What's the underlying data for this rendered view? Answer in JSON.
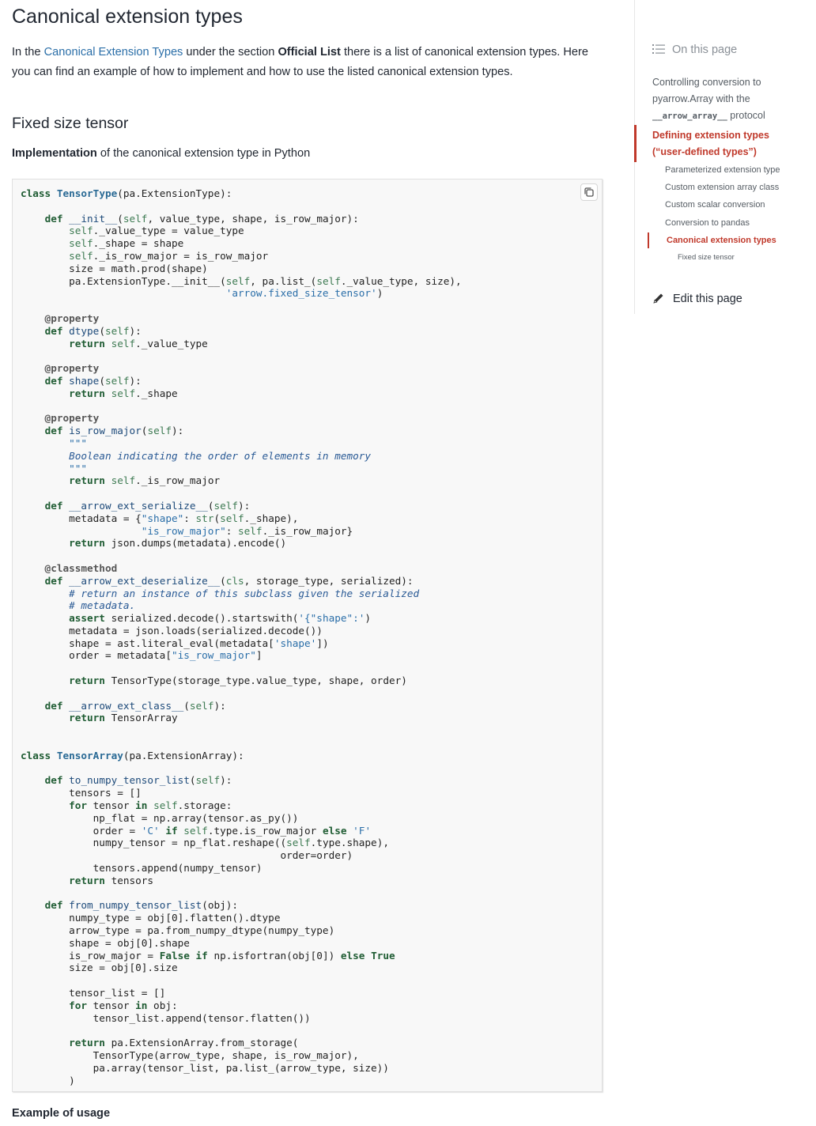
{
  "page": {
    "title": "Canonical extension types",
    "intro": {
      "prefix": "In the ",
      "link": "Canonical Extension Types",
      "middle": " under the section ",
      "bold": "Official List",
      "suffix": " there is a list of canonical extension types. Here you can find an example of how to implement and how to use the listed canonical extension types."
    },
    "section_title": "Fixed size tensor",
    "implementation": {
      "bold": "Implementation",
      "rest": " of the canonical extension type in Python"
    },
    "example_heading": "Example of usage",
    "code_lines": [
      "class TensorType(pa.ExtensionType):",
      "",
      "    def __init__(self, value_type, shape, is_row_major):",
      "        self._value_type = value_type",
      "        self._shape = shape",
      "        self._is_row_major = is_row_major",
      "        size = math.prod(shape)",
      "        pa.ExtensionType.__init__(self, pa.list_(self._value_type, size),",
      "                                  'arrow.fixed_size_tensor')",
      "",
      "    @property",
      "    def dtype(self):",
      "        return self._value_type",
      "",
      "    @property",
      "    def shape(self):",
      "        return self._shape",
      "",
      "    @property",
      "    def is_row_major(self):",
      "        \"\"\"",
      "        Boolean indicating the order of elements in memory",
      "        \"\"\"",
      "        return self._is_row_major",
      "",
      "    def __arrow_ext_serialize__(self):",
      "        metadata = {\"shape\": str(self._shape),",
      "                    \"is_row_major\": self._is_row_major}",
      "        return json.dumps(metadata).encode()",
      "",
      "    @classmethod",
      "    def __arrow_ext_deserialize__(cls, storage_type, serialized):",
      "        # return an instance of this subclass given the serialized",
      "        # metadata.",
      "        assert serialized.decode().startswith('{\"shape\":')",
      "        metadata = json.loads(serialized.decode())",
      "        shape = ast.literal_eval(metadata['shape'])",
      "        order = metadata[\"is_row_major\"]",
      "",
      "        return TensorType(storage_type.value_type, shape, order)",
      "",
      "    def __arrow_ext_class__(self):",
      "        return TensorArray",
      "",
      "",
      "class TensorArray(pa.ExtensionArray):",
      "",
      "    def to_numpy_tensor_list(self):",
      "        tensors = []",
      "        for tensor in self.storage:",
      "            np_flat = np.array(tensor.as_py())",
      "            order = 'C' if self.type.is_row_major else 'F'",
      "            numpy_tensor = np_flat.reshape((self.type.shape),",
      "                                           order=order)",
      "            tensors.append(numpy_tensor)",
      "        return tensors",
      "",
      "    def from_numpy_tensor_list(obj):",
      "        numpy_type = obj[0].flatten().dtype",
      "        arrow_type = pa.from_numpy_dtype(numpy_type)",
      "        shape = obj[0].shape",
      "        is_row_major = False if np.isfortran(obj[0]) else True",
      "        size = obj[0].size",
      "",
      "        tensor_list = []",
      "        for tensor in obj:",
      "            tensor_list.append(tensor.flatten())",
      "",
      "        return pa.ExtensionArray.from_storage(",
      "            TensorType(arrow_type, shape, is_row_major),",
      "            pa.array(tensor_list, pa.list_(arrow_type, size))",
      "        )"
    ]
  },
  "sidebar": {
    "heading": "On this page",
    "items": [
      {
        "pre": "Controlling conversion to pyarrow.Array with the ",
        "mono": "__arrow_array__",
        "post": " protocol"
      },
      {
        "label": "Defining extension types (“user-defined types”)"
      }
    ],
    "subitems": [
      "Parameterized extension type",
      "Custom extension array class",
      "Custom scalar conversion",
      "Conversion to pandas",
      "Canonical extension types"
    ],
    "subsub": "Fixed size tensor",
    "edit": "Edit this page"
  },
  "colors": {
    "accent": "#c0392b",
    "link": "#2a6ea8",
    "keyword": "#1f5c33"
  },
  "icons": {
    "toc": "list-icon",
    "copy": "copy-icon",
    "edit": "pencil-icon"
  }
}
